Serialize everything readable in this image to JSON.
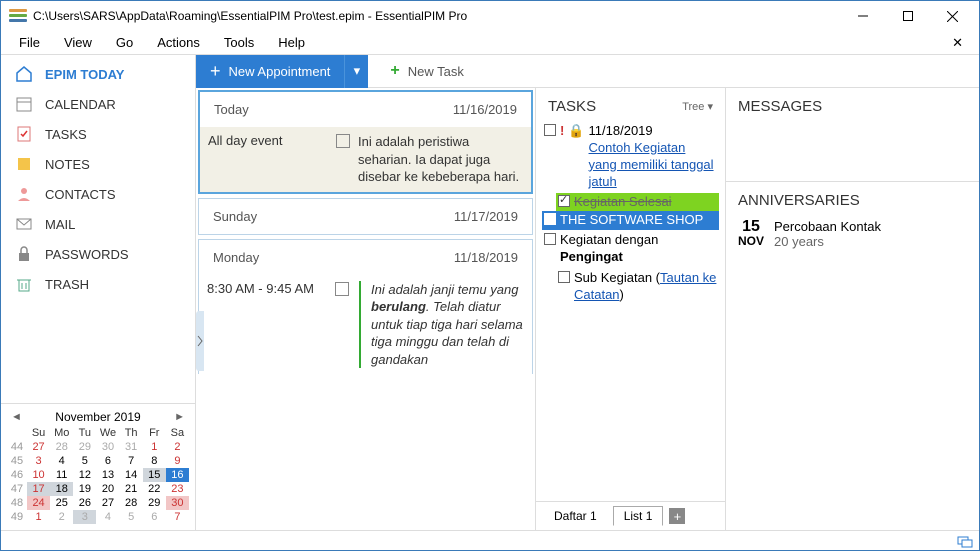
{
  "window": {
    "title": "C:\\Users\\SARS\\AppData\\Roaming\\EssentialPIM Pro\\test.epim - EssentialPIM Pro"
  },
  "menu": {
    "items": [
      "File",
      "View",
      "Go",
      "Actions",
      "Tools",
      "Help"
    ]
  },
  "nav": {
    "items": [
      "EPIM TODAY",
      "CALENDAR",
      "TASKS",
      "NOTES",
      "CONTACTS",
      "MAIL",
      "PASSWORDS",
      "TRASH"
    ],
    "active": 0
  },
  "toolbar": {
    "new_appointment": "New Appointment",
    "new_task": "New Task"
  },
  "agenda": {
    "days": [
      {
        "label": "Today",
        "date": "11/16/2019",
        "events": [
          {
            "time": "All day event",
            "allday": true,
            "text": "Ini adalah peristiwa seharian. Ia dapat juga disebar ke kebeberapa hari."
          }
        ]
      },
      {
        "label": "Sunday",
        "date": "11/17/2019",
        "events": []
      },
      {
        "label": "Monday",
        "date": "11/18/2019",
        "events": [
          {
            "time": "8:30 AM - 9:45 AM",
            "allday": false,
            "text_pre": "Ini adalah janji temu yang ",
            "text_bold": "berulang",
            "text_post": ". Telah diatur untuk tiap tiga hari selama tiga minggu dan telah di gandakan"
          }
        ]
      }
    ]
  },
  "tasks": {
    "title": "TASKS",
    "tree_label": "Tree ▾",
    "t0_date": "11/18/2019",
    "t0_text": "Contoh Kegiatan yang memiliki tanggal jatuh",
    "t1": "Kegiatan Selesai",
    "t2": "THE SOFTWARE SHOP",
    "t3_a": "Kegiatan dengan ",
    "t3_b": "Pengingat",
    "t4_a": "Sub Kegiatan (",
    "t4_link": "Tautan ke Catatan",
    "t4_b": ")",
    "tabs": [
      "Daftar 1",
      "List 1"
    ]
  },
  "messages": {
    "title": "MESSAGES"
  },
  "anniversaries": {
    "title": "ANNIVERSARIES",
    "day": "15",
    "month": "NOV",
    "name": "Percobaan Kontak",
    "age": "20 years"
  },
  "minical": {
    "title": "November  2019",
    "dow": [
      "Su",
      "Mo",
      "Tu",
      "We",
      "Th",
      "Fr",
      "Sa"
    ],
    "weeks": [
      {
        "wk": "44",
        "days": [
          {
            "d": "27",
            "c": "prev sun"
          },
          {
            "d": "28",
            "c": "prev"
          },
          {
            "d": "29",
            "c": "prev"
          },
          {
            "d": "30",
            "c": "prev"
          },
          {
            "d": "31",
            "c": "prev"
          },
          {
            "d": "1",
            "c": "sat"
          },
          {
            "d": "2",
            "c": "sat"
          }
        ]
      },
      {
        "wk": "45",
        "days": [
          {
            "d": "3",
            "c": "sun"
          },
          {
            "d": "4",
            "c": ""
          },
          {
            "d": "5",
            "c": ""
          },
          {
            "d": "6",
            "c": ""
          },
          {
            "d": "7",
            "c": ""
          },
          {
            "d": "8",
            "c": ""
          },
          {
            "d": "9",
            "c": "sat"
          }
        ]
      },
      {
        "wk": "46",
        "days": [
          {
            "d": "10",
            "c": "sun"
          },
          {
            "d": "11",
            "c": ""
          },
          {
            "d": "12",
            "c": ""
          },
          {
            "d": "13",
            "c": ""
          },
          {
            "d": "14",
            "c": ""
          },
          {
            "d": "15",
            "c": "sel"
          },
          {
            "d": "16",
            "c": "today"
          }
        ]
      },
      {
        "wk": "47",
        "days": [
          {
            "d": "17",
            "c": "sun sel"
          },
          {
            "d": "18",
            "c": "sel"
          },
          {
            "d": "19",
            "c": ""
          },
          {
            "d": "20",
            "c": ""
          },
          {
            "d": "21",
            "c": ""
          },
          {
            "d": "22",
            "c": ""
          },
          {
            "d": "23",
            "c": "sat"
          }
        ]
      },
      {
        "wk": "48",
        "days": [
          {
            "d": "24",
            "c": "sun holiday"
          },
          {
            "d": "25",
            "c": ""
          },
          {
            "d": "26",
            "c": ""
          },
          {
            "d": "27",
            "c": ""
          },
          {
            "d": "28",
            "c": ""
          },
          {
            "d": "29",
            "c": ""
          },
          {
            "d": "30",
            "c": "sat holiday"
          }
        ]
      },
      {
        "wk": "49",
        "days": [
          {
            "d": "1",
            "c": "next sun"
          },
          {
            "d": "2",
            "c": "next"
          },
          {
            "d": "3",
            "c": "next sel"
          },
          {
            "d": "4",
            "c": "next"
          },
          {
            "d": "5",
            "c": "next"
          },
          {
            "d": "6",
            "c": "next"
          },
          {
            "d": "7",
            "c": "next sat"
          }
        ]
      }
    ]
  }
}
